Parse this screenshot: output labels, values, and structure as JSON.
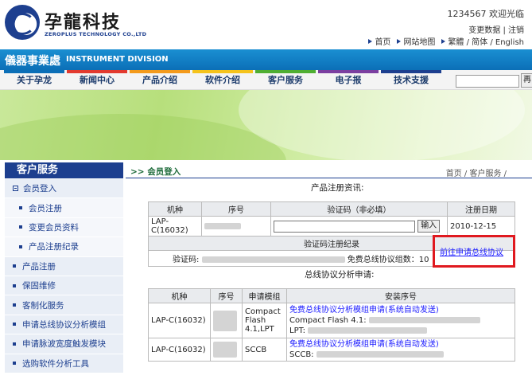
{
  "header": {
    "logo_cn": "孕龍科技",
    "logo_en": "ZEROPLUS TECHNOLOGY CO.,LTD",
    "user_line": "1234567 欢迎光临",
    "change_data": "变更数据",
    "logout": "注销",
    "top_links": [
      "首页",
      "网站地图",
      "繁體 / 简体 / English"
    ]
  },
  "division": {
    "cn": "儀器事業處",
    "en": "INSTRUMENT DIVISION"
  },
  "nav": {
    "items": [
      {
        "label": "关于孕龙",
        "color": "#0b6fb7"
      },
      {
        "label": "新闻中心",
        "color": "#e23a2f"
      },
      {
        "label": "产品介绍",
        "color": "#f39a1c"
      },
      {
        "label": "软件介绍",
        "color": "#f5c31c"
      },
      {
        "label": "客户服务",
        "color": "#4fae32"
      },
      {
        "label": "电子报",
        "color": "#7b3fa0"
      },
      {
        "label": "技术支援",
        "color": "#1d3f8f"
      }
    ],
    "search_btn": "再"
  },
  "sidebar": {
    "title": "客户服务",
    "items": [
      {
        "label": "会员登入",
        "kind": "top-plus"
      },
      {
        "label": "会员注册",
        "kind": "sub"
      },
      {
        "label": "变更会员资料",
        "kind": "sub"
      },
      {
        "label": "产品注册纪录",
        "kind": "sub"
      },
      {
        "label": "产品注册",
        "kind": "top"
      },
      {
        "label": "保固维修",
        "kind": "top"
      },
      {
        "label": "客制化服务",
        "kind": "top"
      },
      {
        "label": "申请总线协议分析模组",
        "kind": "top"
      },
      {
        "label": "申请脉波宽度触发模块",
        "kind": "top"
      },
      {
        "label": "选购软件分析工具",
        "kind": "top"
      }
    ]
  },
  "breadcrumb": {
    "left": ">> 会员登入",
    "right": "首页 / 客户服务 /"
  },
  "registration": {
    "title": "产品注册资讯:",
    "headers": [
      "机种",
      "序号",
      "验证码（非必填）",
      "注册日期"
    ],
    "row": {
      "model": "LAP-C(16032)",
      "enter_btn": "输入",
      "date": "2010-12-15"
    },
    "verify_title": "验证码注册纪录",
    "verify_label": "验证码:",
    "free_label": "免费总线协议组数：10",
    "apply_link": "前往申请总线协议"
  },
  "bus": {
    "title": "总线协议分析申请:",
    "headers": [
      "机种",
      "序号",
      "申请模组",
      "安装序号"
    ],
    "rows": [
      {
        "model": "LAP-C(16032)",
        "module": "Compact Flash 4.1,LPT",
        "link": "免费总线协议分析模组申请(系统自动发送)",
        "line1": "Compact Flash 4.1:",
        "line2": "LPT:"
      },
      {
        "model": "LAP-C(16032)",
        "module": "SCCB",
        "link": "免费总线协议分析模组申请(系统自动发送)",
        "line1": "SCCB:"
      }
    ]
  }
}
